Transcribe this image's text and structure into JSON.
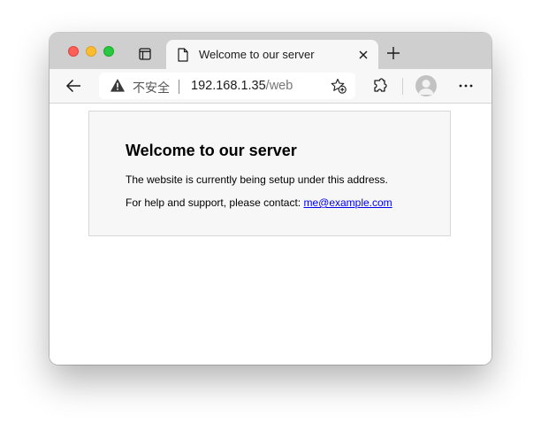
{
  "tab": {
    "title": "Welcome to our server"
  },
  "address_bar": {
    "security_label": "不安全",
    "url_host": "192.168.1.35",
    "url_path": "/web"
  },
  "icons": {
    "tab_actions": "tab-actions-icon",
    "page": "page-icon",
    "close_tab": "close-icon",
    "new_tab": "plus-icon",
    "back": "arrow-left-icon",
    "warning": "warning-triangle-icon",
    "favorites": "star-plus-icon",
    "extensions": "puzzle-icon",
    "profile": "avatar-icon",
    "more": "ellipsis-icon"
  },
  "colors": {
    "traffic_close": "#fe5f57",
    "traffic_minimize": "#febc2e",
    "traffic_maximize": "#28c840",
    "link": "#0000ee"
  },
  "page": {
    "heading": "Welcome to our server",
    "setup_text": "The website is currently being setup under this address.",
    "contact_text": "For help and support, please contact: ",
    "contact_email": "me@example.com"
  }
}
